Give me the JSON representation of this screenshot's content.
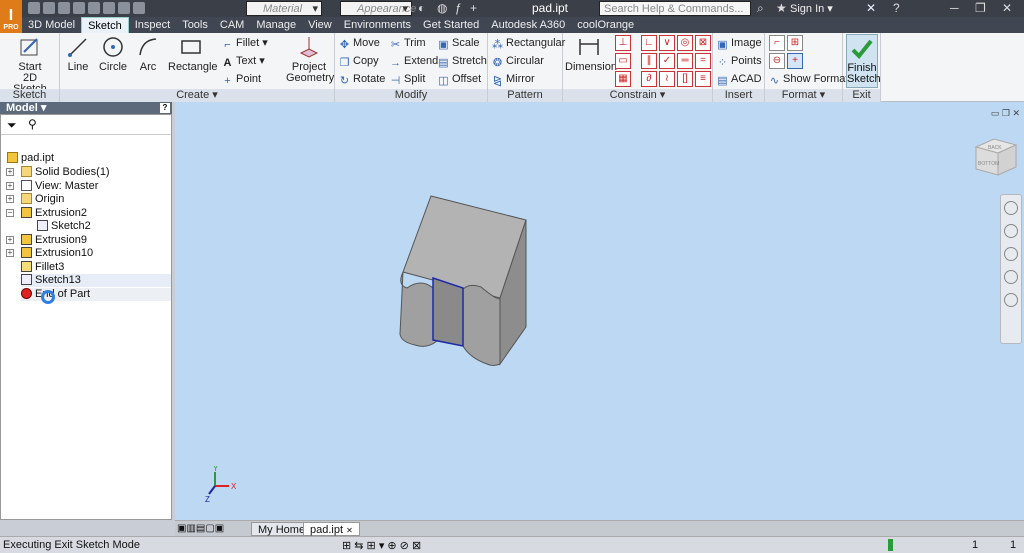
{
  "app": {
    "badge": "PRO",
    "document_title": "pad.ipt"
  },
  "titlebar": {
    "material_placeholder": "Material",
    "appearance_placeholder": "Appearance",
    "search_placeholder": "Search Help & Commands...",
    "sign_in": "Sign In"
  },
  "menu": [
    "3D Model",
    "Sketch",
    "Inspect",
    "Tools",
    "CAM",
    "Manage",
    "View",
    "Environments",
    "Get Started",
    "Autodesk A360",
    "coolOrange"
  ],
  "ribbon": {
    "sketch_panel": {
      "title": "Sketch",
      "start_2d": [
        "Start",
        "2D Sketch"
      ]
    },
    "create_panel": {
      "title": "Create",
      "line": "Line",
      "circle": "Circle",
      "arc": "Arc",
      "rectangle": "Rectangle",
      "fillet": "Fillet",
      "text": "Text",
      "point": "Point",
      "project": [
        "Project",
        "Geometry"
      ]
    },
    "modify_panel": {
      "title": "Modify",
      "move": "Move",
      "copy": "Copy",
      "rotate": "Rotate",
      "trim": "Trim",
      "extend": "Extend",
      "split": "Split",
      "scale": "Scale",
      "stretch": "Stretch",
      "offset": "Offset"
    },
    "pattern_panel": {
      "title": "Pattern",
      "rectangular": "Rectangular",
      "circular": "Circular",
      "mirror": "Mirror"
    },
    "constrain_panel": {
      "title": "Constrain",
      "dimension": "Dimension"
    },
    "insert_panel": {
      "title": "Insert",
      "image": "Image",
      "points": "Points",
      "acad": "ACAD"
    },
    "format_panel": {
      "title": "Format",
      "show_format": "Show Format"
    },
    "exit_panel": {
      "title": "Exit",
      "finish": [
        "Finish",
        "Sketch"
      ]
    }
  },
  "browser": {
    "title": "Model",
    "help": "?",
    "items": [
      {
        "label": "pad.ipt",
        "indent": 0,
        "icon": "part"
      },
      {
        "label": "Solid Bodies(1)",
        "indent": 1,
        "icon": "folder"
      },
      {
        "label": "View: Master",
        "indent": 1,
        "icon": "view"
      },
      {
        "label": "Origin",
        "indent": 1,
        "icon": "folder"
      },
      {
        "label": "Extrusion2",
        "indent": 1,
        "icon": "extrusion"
      },
      {
        "label": "Sketch2",
        "indent": 2,
        "icon": "sketch"
      },
      {
        "label": "Extrusion9",
        "indent": 1,
        "icon": "extrusion"
      },
      {
        "label": "Extrusion10",
        "indent": 1,
        "icon": "extrusion"
      },
      {
        "label": "Fillet3",
        "indent": 1,
        "icon": "fillet"
      },
      {
        "label": "Sketch13",
        "indent": 1,
        "icon": "sketch"
      },
      {
        "label": "End of Part",
        "indent": 1,
        "icon": "end"
      }
    ]
  },
  "viewcube": {
    "top_label": "BACK",
    "front_label": "BOTTOM"
  },
  "triad": {
    "x": "X",
    "y": "Y",
    "z": "Z"
  },
  "tabs": [
    "My Home",
    "pad.ipt"
  ],
  "status": {
    "text": "Executing Exit Sketch Mode",
    "count1": "1",
    "count2": "1"
  },
  "colors": {
    "accent": "#e07b1a",
    "viewport": "#bcd8f3",
    "selection": "#2233aa"
  }
}
